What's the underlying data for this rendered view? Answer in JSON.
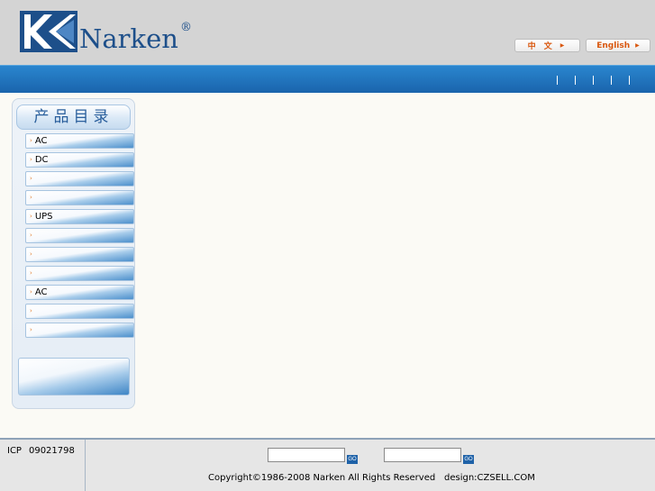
{
  "header": {
    "brand": "Narken",
    "registered_mark": "®",
    "lang_zh": "中 文",
    "lang_en": "English",
    "brand_color": "#1d4f8a",
    "accent_color": "#d9570e"
  },
  "nav": {
    "bar_color": "#1f6fb8",
    "separator_count": 5
  },
  "sidebar": {
    "title": "产品目录",
    "items": [
      {
        "label": "AC"
      },
      {
        "label": "DC"
      },
      {
        "label": ""
      },
      {
        "label": ""
      },
      {
        "label": "UPS"
      },
      {
        "label": ""
      },
      {
        "label": ""
      },
      {
        "label": ""
      },
      {
        "label": "AC"
      },
      {
        "label": ""
      },
      {
        "label": ""
      }
    ]
  },
  "footer": {
    "icp_label": "ICP",
    "icp_number": "09021798",
    "search1_value": "",
    "search2_value": "",
    "go_label": "GO",
    "copyright": "Copyright©1986-2008 Narken All Rights Reserved",
    "design": "design:CZSELL.COM"
  }
}
